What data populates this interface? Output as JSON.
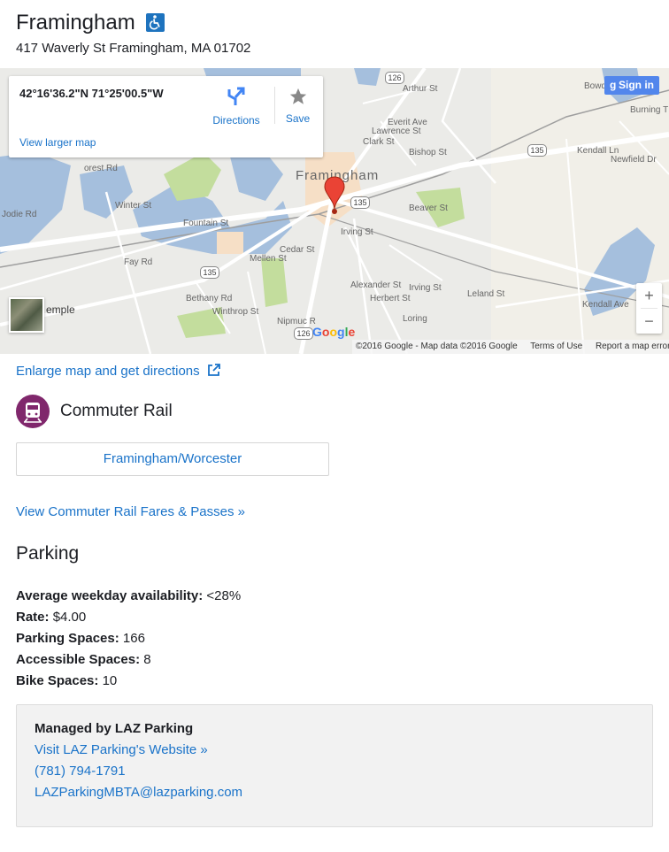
{
  "station": {
    "name": "Framingham",
    "address": "417 Waverly St Framingham, MA 01702",
    "accessible_icon": "wheelchair-icon"
  },
  "map": {
    "coords": "42°16'36.2\"N 71°25'00.5\"W",
    "directions_label": "Directions",
    "save_label": "Save",
    "larger_map_label": "View larger map",
    "signin_label": "Sign in",
    "zoom_in": "+",
    "zoom_out": "−",
    "town_label": "Framingham",
    "google_logo": "Google",
    "attribution": "©2016 Google - Map data ©2016 Google",
    "terms": "Terms of Use",
    "report": "Report a map error",
    "streets": {
      "arthur": "Arthur St",
      "everit": "Everit Ave",
      "lawrence": "Lawrence St",
      "clark": "Clark St",
      "bishop": "Bishop St",
      "beaver": "Beaver St",
      "irving1": "Irving St",
      "irving2": "Irving St",
      "alexander": "Alexander St",
      "herbert": "Herbert St",
      "loring": "Loring",
      "leland": "Leland St",
      "kendall_ave": "Kendall Ave",
      "kendall_ln": "Kendall Ln",
      "newfield": "Newfield Dr",
      "burning": "Burning T",
      "bowden": "Bowden Ln",
      "fountain": "Fountain St",
      "winter": "Winter St",
      "fay": "Fay Rd",
      "bethany": "Bethany Rd",
      "winthrop": "Winthrop St",
      "mellen": "Mellen St",
      "cedar": "Cedar St",
      "nipmuc": "Nipmuc R",
      "jodie": "Jodie Rd",
      "temple": "emple",
      "forest": "orest Rd"
    },
    "shields": {
      "r126a": "126",
      "r126b": "126",
      "r135a": "135",
      "r135b": "135",
      "r135c": "135"
    }
  },
  "enlarge_link": "Enlarge map and get directions",
  "commuter_rail": {
    "title": "Commuter Rail",
    "line": "Framingham/Worcester",
    "fares_link": "View Commuter Rail Fares & Passes »"
  },
  "parking": {
    "title": "Parking",
    "facts": [
      {
        "label": "Average weekday availability:",
        "value": "<28%"
      },
      {
        "label": "Rate:",
        "value": "$4.00"
      },
      {
        "label": "Parking Spaces:",
        "value": "166"
      },
      {
        "label": "Accessible Spaces:",
        "value": "8"
      },
      {
        "label": "Bike Spaces:",
        "value": "10"
      }
    ],
    "managed_by": "Managed by LAZ Parking",
    "website_link": "Visit LAZ Parking's Website »",
    "phone": "(781) 794-1791",
    "email": "LAZParkingMBTA@lazparking.com"
  },
  "colors": {
    "link": "#1a73c9",
    "commuter_rail": "#80276c",
    "accessible": "#1e73be"
  }
}
